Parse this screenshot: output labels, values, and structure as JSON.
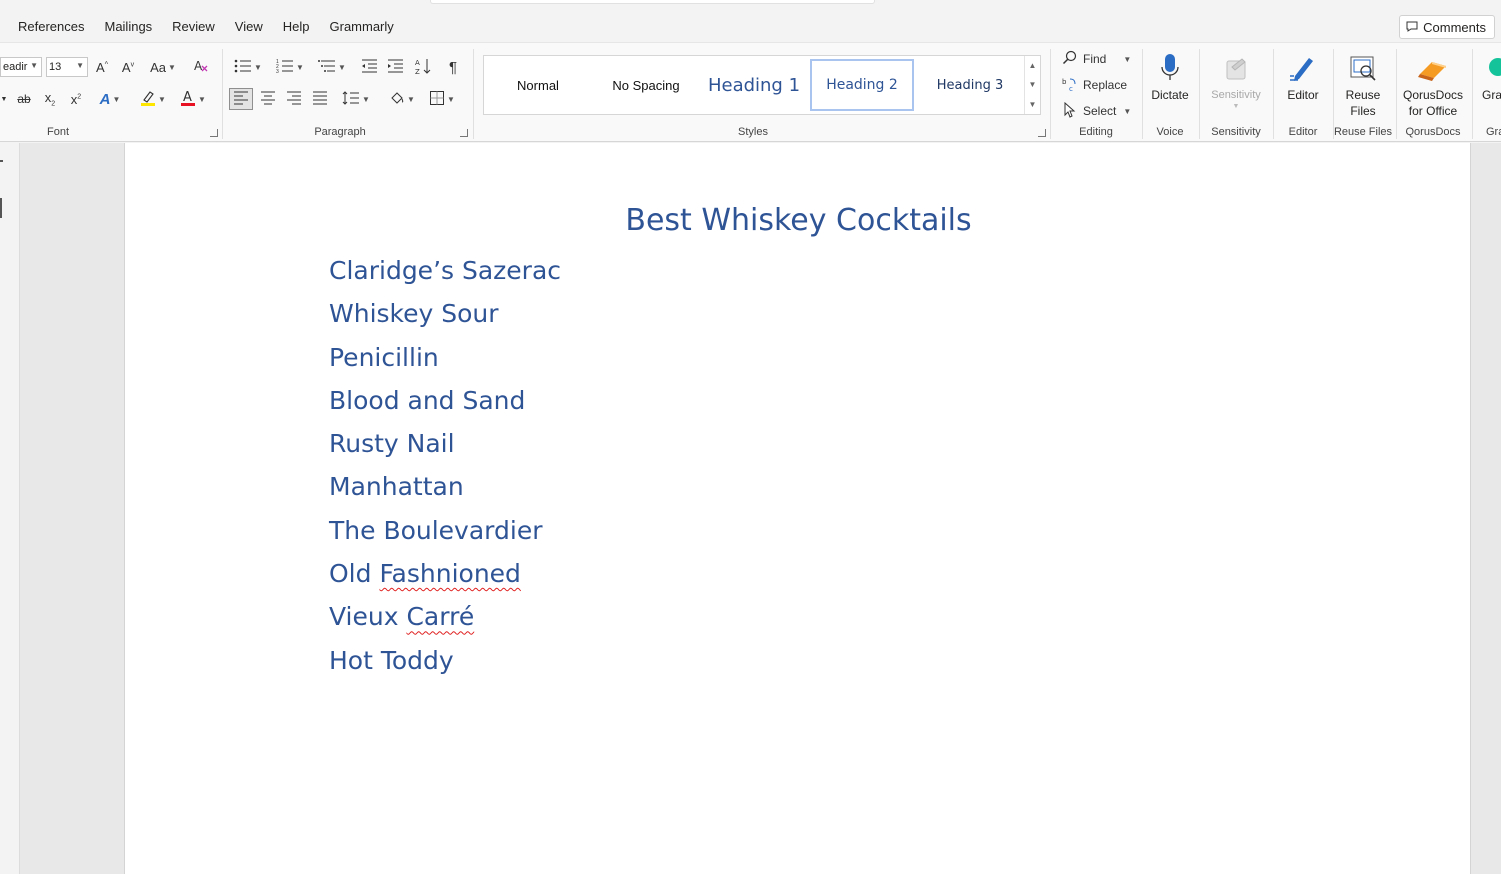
{
  "menu": {
    "tabs": [
      "References",
      "Mailings",
      "Review",
      "View",
      "Help",
      "Grammarly"
    ],
    "comments_label": "Comments"
  },
  "ribbon": {
    "font": {
      "font_name": "eadir",
      "font_size": "13",
      "label": "Font"
    },
    "paragraph": {
      "label": "Paragraph"
    },
    "styles": {
      "label": "Styles",
      "items": [
        "Normal",
        "No Spacing",
        "Heading 1",
        "Heading 2",
        "Heading 3"
      ],
      "selected": "Heading 2"
    },
    "editing": {
      "label": "Editing",
      "find": "Find",
      "replace": "Replace",
      "select": "Select"
    },
    "voice": {
      "button": "Dictate",
      "label": "Voice"
    },
    "sensitivity": {
      "button": "Sensitivity",
      "label": "Sensitivity"
    },
    "editor": {
      "button": "Editor",
      "label": "Editor"
    },
    "reuse": {
      "button_line1": "Reuse",
      "button_line2": "Files",
      "label": "Reuse Files"
    },
    "qorus": {
      "button_line1": "QorusDocs",
      "button_line2": "for Office",
      "label": "QorusDocs"
    },
    "grammarly": {
      "button": "Gra",
      "label": "Gra"
    }
  },
  "document": {
    "title": "Best Whiskey Cocktails",
    "items": [
      "Claridge’s Sazerac",
      "Whiskey Sour",
      "Penicillin",
      "Blood and Sand",
      "Rusty Nail",
      "Manhattan",
      "The Boulevardier",
      "Old Fashnioned",
      "Vieux Carré",
      "Hot Toddy"
    ],
    "misspelled_words": [
      "Fashnioned",
      "Carré"
    ]
  },
  "colors": {
    "heading_blue": "#2f5496",
    "spell_red": "#e02020",
    "selection_border": "#a9c4ee"
  }
}
